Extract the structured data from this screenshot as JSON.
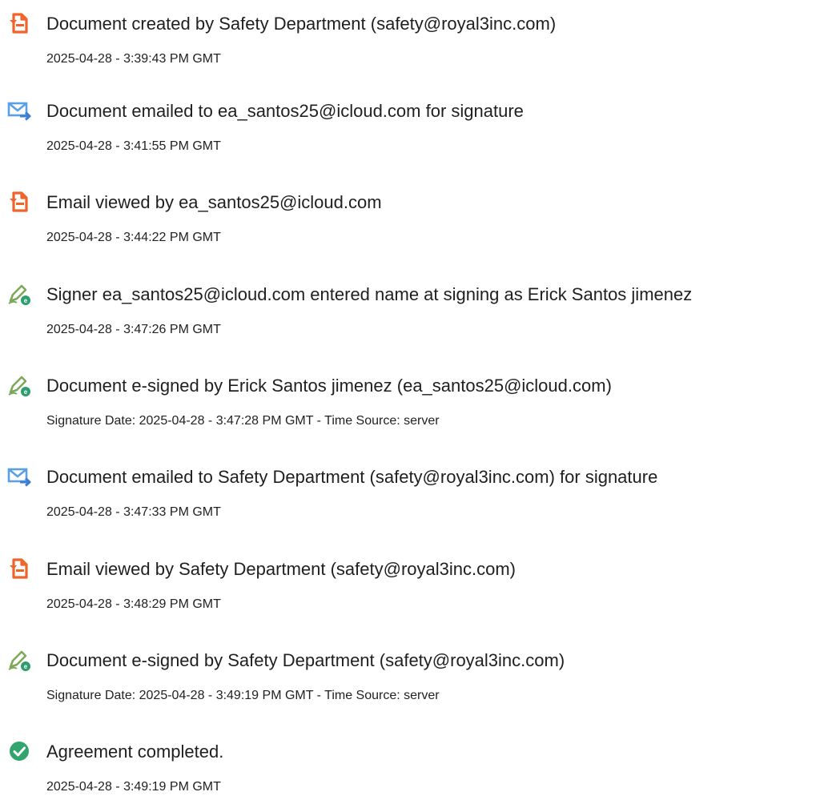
{
  "colors": {
    "document_icon": "#f0642a",
    "email_icon": "#5aa0e6",
    "email_arrow": "#3f7fd1",
    "sign_pen": "#7da85a",
    "sign_badge": "#2e9e6e",
    "complete_check": "#32a56f"
  },
  "events": [
    {
      "icon": "document-icon",
      "title": "Document created by Safety Department (safety@royal3inc.com)",
      "time": "2025-04-28 - 3:39:43 PM GMT"
    },
    {
      "icon": "email-icon",
      "title": "Document emailed to ea_santos25@icloud.com for signature",
      "time": "2025-04-28 - 3:41:55 PM GMT"
    },
    {
      "icon": "document-icon",
      "title": "Email viewed by ea_santos25@icloud.com",
      "time": "2025-04-28 - 3:44:22 PM GMT"
    },
    {
      "icon": "esign-pen-icon",
      "title": "Signer ea_santos25@icloud.com entered name at signing as Erick Santos jimenez",
      "time": "2025-04-28 - 3:47:26 PM GMT"
    },
    {
      "icon": "esign-pen-icon",
      "title": "Document e-signed by Erick Santos jimenez (ea_santos25@icloud.com)",
      "time": "Signature Date: 2025-04-28 - 3:47:28 PM GMT - Time Source: server"
    },
    {
      "icon": "email-icon",
      "title": "Document emailed to Safety Department (safety@royal3inc.com) for signature",
      "time": "2025-04-28 - 3:47:33 PM GMT"
    },
    {
      "icon": "document-icon",
      "title": "Email viewed by Safety Department (safety@royal3inc.com)",
      "time": "2025-04-28 - 3:48:29 PM GMT"
    },
    {
      "icon": "esign-pen-icon",
      "title": "Document e-signed by Safety Department (safety@royal3inc.com)",
      "time": "Signature Date: 2025-04-28 - 3:49:19 PM GMT - Time Source: server"
    },
    {
      "icon": "check-circle-icon",
      "title": "Agreement completed.",
      "time": "2025-04-28 - 3:49:19 PM GMT"
    }
  ]
}
